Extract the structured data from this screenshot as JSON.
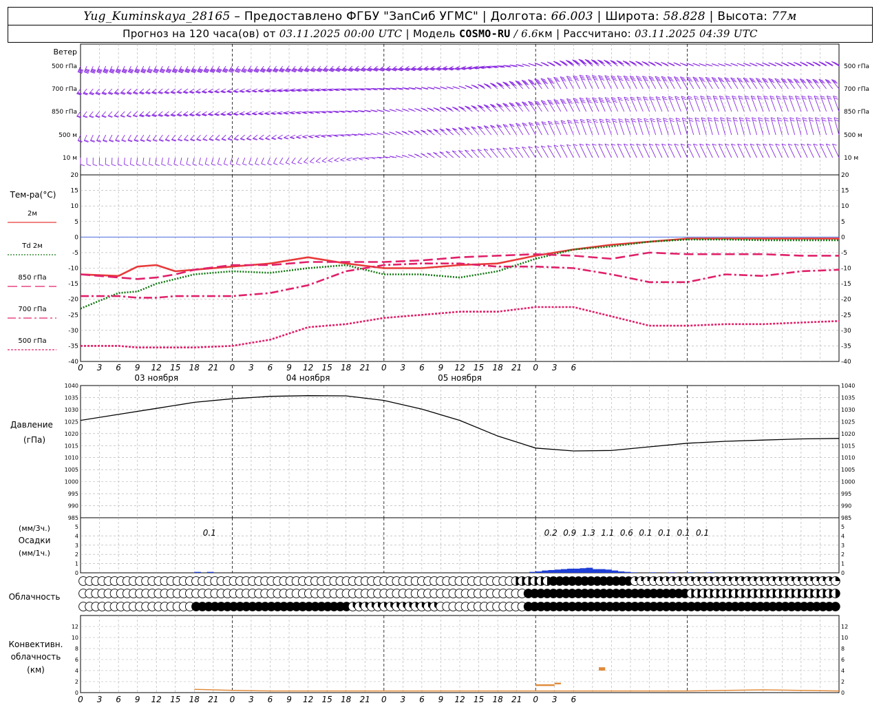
{
  "header": {
    "station": "Yug_Kuminskaya_28165",
    "provider": " – Предоставлено ФГБУ \"ЗапСиб УГМС\" | Долгота: ",
    "lon": "66.003",
    "lat_label": " | Широта: ",
    "lat": "58.828",
    "alt_label": " | Высота: ",
    "alt": "77м",
    "forecast_label": "Прогноз на 120 часа(ов) от ",
    "init": "03.11.2025 00:00 UTC",
    "model_label": " | Модель ",
    "model": "COSMO-RU",
    "res": " / 6.6",
    "res_unit": "км",
    "calc_label": " | Рассчитано: ",
    "calc": "03.11.2025 04:39 UTC"
  },
  "colors": {
    "wind": "#8a2be2",
    "t2m": "#e83a3a",
    "td2m": "#117711",
    "t850": "#e0206a",
    "t700": "#e0206a",
    "t500": "#e0206a",
    "zero_line": "#3355dd",
    "pressure": "#000000",
    "precip": "#1f3fd6",
    "conv": "#e08a3a",
    "grid": "#aaaaaa"
  },
  "wind_panel": {
    "title": "Ветер",
    "levels": [
      "500 гПа",
      "700 гПа",
      "850 гПа",
      "500 м",
      "10 м"
    ]
  },
  "temp_panel": {
    "title": "Тем-ра(°C)",
    "legend": [
      "2м",
      "Td 2м",
      "850 гПа",
      "700 гПа",
      "500 гПа"
    ]
  },
  "pressure_panel": {
    "title": "Давление",
    "unit": "(гПа)"
  },
  "precip_panel": {
    "unit_top": "(мм/3ч.)",
    "title": "Осадки",
    "unit_bottom": "(мм/1ч.)"
  },
  "cloud_panel": {
    "title": "Облачность"
  },
  "conv_panel": {
    "title": [
      "Конвективн.",
      "облачность",
      "(км)"
    ]
  },
  "x_labels": [
    "0",
    "3",
    "6",
    "9",
    "12",
    "15",
    "18",
    "21",
    "0",
    "3",
    "6",
    "9",
    "12",
    "15",
    "18",
    "21",
    "0",
    "3",
    "6",
    "9",
    "12",
    "15",
    "18",
    "21",
    "0",
    "3",
    "6"
  ],
  "date_labels": [
    "03 ноября",
    "04 ноября",
    "05 ноября"
  ],
  "chart_data": [
    {
      "type": "line",
      "title": "Тем-ра(°C)",
      "ylim": [
        -40,
        20
      ],
      "yticks": [
        20,
        15,
        10,
        5,
        0,
        -5,
        -10,
        -15,
        -20,
        -25,
        -30,
        -35,
        -40
      ],
      "x_hours": [
        0,
        6,
        9,
        12,
        15,
        18,
        24,
        30,
        36,
        42,
        48,
        54,
        60,
        66,
        72,
        78,
        84,
        90,
        96,
        102,
        108,
        114,
        120
      ],
      "series": [
        {
          "name": "2м",
          "key": "t2m",
          "dash": "",
          "values": [
            -12,
            -12.5,
            -9.5,
            -9,
            -11,
            -10.5,
            -9.5,
            -8.5,
            -6.5,
            -8.5,
            -10,
            -10,
            -9,
            -8.5,
            -6,
            -4,
            -2.5,
            -1.5,
            -0.5,
            -0.5,
            -0.5,
            -0.5,
            -0.5
          ]
        },
        {
          "name": "Td 2м",
          "key": "td2m",
          "dash": "2,2",
          "values": [
            -23,
            -18,
            -17.5,
            -15,
            -13.5,
            -12,
            -11,
            -11.5,
            -10,
            -9,
            -12,
            -12,
            -13,
            -11,
            -7,
            -4,
            -3,
            -1.5,
            -0.8,
            -0.8,
            -1,
            -1,
            -1
          ]
        },
        {
          "name": "850 гПа",
          "key": "t850",
          "dash": "14,6",
          "values": [
            -12,
            -13,
            -13.5,
            -13,
            -12,
            -10.5,
            -9,
            -9,
            -8,
            -8,
            -8,
            -7.5,
            -6.5,
            -6,
            -5.5,
            -6,
            -7,
            -5,
            -5.5,
            -5.5,
            -5.5,
            -6,
            -6
          ]
        },
        {
          "name": "700 гПа",
          "key": "t700",
          "dash": "12,4,3,4",
          "values": [
            -19,
            -19,
            -19.5,
            -19.5,
            -19,
            -19,
            -19,
            -18,
            -15.5,
            -11,
            -9,
            -8.5,
            -8.5,
            -9.5,
            -9.5,
            -10,
            -12,
            -14.5,
            -14.5,
            -12,
            -12.5,
            -11,
            -10.5
          ]
        },
        {
          "name": "500 гПа",
          "key": "t500",
          "dash": "3,2",
          "values": [
            -35,
            -35,
            -35.5,
            -35.5,
            -35.5,
            -35.5,
            -35,
            -33,
            -29,
            -28,
            -26,
            -25,
            -24,
            -24,
            -22.5,
            -22.5,
            -25.5,
            -28.5,
            -28.5,
            -28,
            -28,
            -27.5,
            -27
          ]
        }
      ]
    },
    {
      "type": "line",
      "title": "Давление",
      "ylabel": "(гПа)",
      "ylim": [
        985,
        1040
      ],
      "yticks": [
        1040,
        1035,
        1030,
        1025,
        1020,
        1015,
        1010,
        1005,
        1000,
        995,
        990,
        985
      ],
      "x_hours": [
        0,
        6,
        12,
        18,
        24,
        30,
        36,
        42,
        48,
        54,
        60,
        66,
        72,
        78,
        84,
        90,
        96,
        102,
        108,
        114,
        120
      ],
      "series": [
        {
          "name": "",
          "values": [
            1025.5,
            1028,
            1030.5,
            1033,
            1034.5,
            1035.5,
            1035.8,
            1035.7,
            1033.8,
            1030.2,
            1025.5,
            1019,
            1014,
            1012.8,
            1013,
            1014.5,
            1016,
            1016.8,
            1017.3,
            1017.8,
            1018
          ]
        }
      ]
    },
    {
      "type": "bar",
      "title": "Осадки",
      "ylim": [
        0,
        5
      ],
      "yticks": [
        5,
        4,
        3,
        2,
        1,
        0
      ],
      "labels_3h": [
        {
          "hour": 18,
          "text": "0.1"
        },
        {
          "hour": 72,
          "text": "0.2"
        },
        {
          "hour": 75,
          "text": "0.9"
        },
        {
          "hour": 78,
          "text": "1.3"
        },
        {
          "hour": 81,
          "text": "1.1"
        },
        {
          "hour": 84,
          "text": "0.6"
        },
        {
          "hour": 87,
          "text": "0.1"
        },
        {
          "hour": 90,
          "text": "0.1"
        },
        {
          "hour": 93,
          "text": "0.1"
        },
        {
          "hour": 96,
          "text": "0.1"
        }
      ],
      "bars_1h": [
        [
          18,
          0.1
        ],
        [
          20,
          0.1
        ],
        [
          71,
          0.1
        ],
        [
          72,
          0.15
        ],
        [
          73,
          0.25
        ],
        [
          74,
          0.3
        ],
        [
          75,
          0.35
        ],
        [
          76,
          0.4
        ],
        [
          77,
          0.45
        ],
        [
          78,
          0.45
        ],
        [
          79,
          0.5
        ],
        [
          80,
          0.55
        ],
        [
          81,
          0.4
        ],
        [
          82,
          0.4
        ],
        [
          83,
          0.35
        ],
        [
          84,
          0.25
        ],
        [
          85,
          0.15
        ],
        [
          86,
          0.1
        ],
        [
          87,
          0.05
        ],
        [
          90,
          0.05
        ],
        [
          93,
          0.05
        ],
        [
          96,
          0.05
        ],
        [
          99,
          0.05
        ]
      ]
    },
    {
      "type": "table",
      "title": "Облачность",
      "note": "cloud fraction (oktas 0-8) per hour, rows: upper, middle, lower",
      "segments": [
        {
          "row": 0,
          "from": 0,
          "to": 68,
          "value": 0
        },
        {
          "row": 0,
          "from": 69,
          "to": 74,
          "value": 4
        },
        {
          "row": 0,
          "from": 75,
          "to": 87,
          "value": 8
        },
        {
          "row": 0,
          "from": 88,
          "to": 120,
          "value": 2
        },
        {
          "row": 1,
          "from": 0,
          "to": 70,
          "value": 0
        },
        {
          "row": 1,
          "from": 71,
          "to": 96,
          "value": 8
        },
        {
          "row": 1,
          "from": 97,
          "to": 120,
          "value": 4
        },
        {
          "row": 2,
          "from": 0,
          "to": 17,
          "value": 0
        },
        {
          "row": 2,
          "from": 18,
          "to": 42,
          "value": 8
        },
        {
          "row": 2,
          "from": 43,
          "to": 56,
          "value": 3
        },
        {
          "row": 2,
          "from": 57,
          "to": 70,
          "value": 0
        },
        {
          "row": 2,
          "from": 71,
          "to": 120,
          "value": 8
        }
      ]
    },
    {
      "type": "bar",
      "title": "Конвективн. облачность (км)",
      "ylim": [
        0,
        14
      ],
      "yticks": [
        12,
        10,
        8,
        6,
        4,
        2,
        0
      ],
      "tops": [
        {
          "from": 72,
          "to": 75,
          "top": 1.5,
          "base": 1.2
        },
        {
          "from": 75,
          "to": 76,
          "top": 1.8,
          "base": 1.5
        },
        {
          "from": 82,
          "to": 83,
          "top": 4.6,
          "base": 4.0
        }
      ],
      "low_line": [
        [
          18,
          0.6
        ],
        [
          24,
          0.4
        ],
        [
          30,
          0.3
        ],
        [
          72,
          0.3
        ],
        [
          84,
          0.3
        ],
        [
          96,
          0.3
        ],
        [
          108,
          0.5
        ],
        [
          120,
          0.3
        ]
      ]
    },
    {
      "type": "table",
      "title": "Ветер",
      "levels": [
        "500 гПа",
        "700 гПа",
        "850 гПа",
        "500 м",
        "10 м"
      ],
      "wind_dir_deg": {
        "500 гПа": [
          [
            0,
            200
          ],
          [
            30,
            210
          ],
          [
            60,
            225
          ],
          [
            80,
            270
          ],
          [
            100,
            250
          ],
          [
            120,
            260
          ]
        ],
        "700 гПа": [
          [
            0,
            210
          ],
          [
            30,
            230
          ],
          [
            60,
            250
          ],
          [
            80,
            300
          ],
          [
            100,
            290
          ],
          [
            120,
            280
          ]
        ],
        "850 гПа": [
          [
            0,
            210
          ],
          [
            30,
            230
          ],
          [
            60,
            260
          ],
          [
            80,
            300
          ],
          [
            100,
            310
          ],
          [
            120,
            310
          ]
        ],
        "500 м": [
          [
            0,
            200
          ],
          [
            30,
            220
          ],
          [
            60,
            270
          ],
          [
            80,
            310
          ],
          [
            100,
            320
          ],
          [
            120,
            320
          ]
        ],
        "10 м": [
          [
            0,
            180
          ],
          [
            30,
            200
          ],
          [
            60,
            270
          ],
          [
            80,
            300
          ],
          [
            100,
            300
          ],
          [
            120,
            300
          ]
        ]
      },
      "wind_speed_ms": {
        "500 гПа": [
          [
            0,
            25
          ],
          [
            60,
            30
          ],
          [
            90,
            20
          ],
          [
            120,
            25
          ]
        ],
        "700 гПа": [
          [
            0,
            15
          ],
          [
            60,
            20
          ],
          [
            90,
            15
          ],
          [
            120,
            15
          ]
        ],
        "850 гПа": [
          [
            0,
            12
          ],
          [
            60,
            15
          ],
          [
            90,
            12
          ],
          [
            120,
            10
          ]
        ],
        "500 м": [
          [
            0,
            10
          ],
          [
            60,
            12
          ],
          [
            90,
            10
          ],
          [
            120,
            8
          ]
        ],
        "10 м": [
          [
            0,
            4
          ],
          [
            60,
            5
          ],
          [
            90,
            5
          ],
          [
            120,
            4
          ]
        ]
      }
    }
  ]
}
